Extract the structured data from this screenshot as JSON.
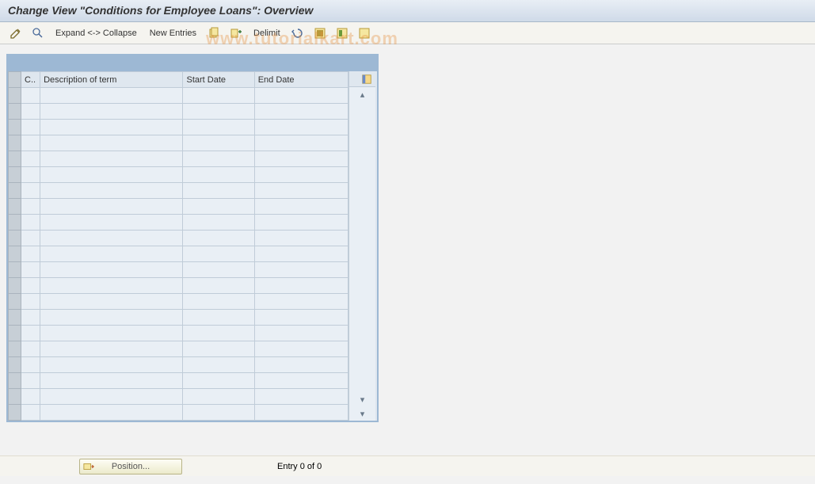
{
  "title": "Change View \"Conditions for Employee Loans\": Overview",
  "toolbar": {
    "expand_collapse": "Expand <-> Collapse",
    "new_entries": "New Entries",
    "delimit": "Delimit"
  },
  "table": {
    "columns": {
      "c": "C..",
      "desc": "Description of term",
      "start": "Start Date",
      "end": "End Date"
    },
    "row_count_visible": 21
  },
  "footer": {
    "position_label": "Position...",
    "entry_status": "Entry 0 of 0"
  },
  "watermark": "www.tutorialkart.com"
}
